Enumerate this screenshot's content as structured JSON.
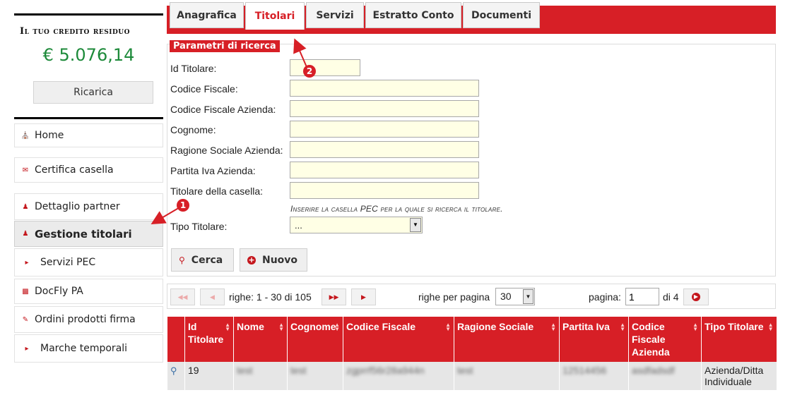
{
  "credit": {
    "title": "Il tuo credito residuo",
    "value": "€ 5.076,14",
    "recharge_label": "Ricarica"
  },
  "nav": {
    "items": [
      {
        "label": "Home",
        "icon": "home-icon"
      },
      {
        "label": "Certifica casella",
        "icon": "envelope-icon"
      },
      {
        "label": "Dettaglio partner",
        "icon": "user-icon"
      },
      {
        "label": "Gestione titolari",
        "icon": "user-icon"
      },
      {
        "label": "Servizi PEC",
        "icon": "caret-right-icon"
      },
      {
        "label": "DocFly PA",
        "icon": "folder-icon"
      },
      {
        "label": "Ordini prodotti firma",
        "icon": "pen-icon"
      },
      {
        "label": "Marche temporali",
        "icon": "caret-right-icon"
      }
    ]
  },
  "tabs": [
    {
      "label": "Anagrafica"
    },
    {
      "label": "Titolari"
    },
    {
      "label": "Servizi"
    },
    {
      "label": "Estratto Conto"
    },
    {
      "label": "Documenti"
    }
  ],
  "search": {
    "heading": "Parametri di ricerca",
    "fields": [
      {
        "label": "Id Titolare:",
        "value": ""
      },
      {
        "label": "Codice Fiscale:",
        "value": ""
      },
      {
        "label": "Codice Fiscale Azienda:",
        "value": ""
      },
      {
        "label": "Cognome:",
        "value": ""
      },
      {
        "label": "Ragione Sociale Azienda:",
        "value": ""
      },
      {
        "label": "Partita Iva Azienda:",
        "value": ""
      },
      {
        "label": "Titolare della casella:",
        "value": ""
      }
    ],
    "pec_hint": "Inserire la casella PEC per la quale si ricerca il titolare.",
    "type_label": "Tipo Titolare:",
    "type_value": "...",
    "search_button": "Cerca",
    "new_button": "Nuovo"
  },
  "pager": {
    "rows_text": "righe: 1 - 30 di 105",
    "per_page_label": "righe per pagina",
    "per_page_value": "30",
    "page_label": "pagina:",
    "page_value": "1",
    "page_total": "di 4"
  },
  "table": {
    "columns": [
      "Id Titolare",
      "Nome",
      "Cognome",
      "Codice Fiscale",
      "Ragione Sociale",
      "Partita Iva",
      "Codice Fiscale Azienda",
      "Tipo Titolare"
    ],
    "rows": [
      {
        "id": "19",
        "nome": "test",
        "cognome": "test",
        "cf": "zgprrf56r28a944n",
        "ragione": "test",
        "piva": "12514456",
        "cf_azienda": "asdfadsdf",
        "tipo": "Azienda/Ditta Individuale"
      }
    ]
  },
  "annotations": {
    "badge_1": "1",
    "badge_2": "2"
  },
  "colors": {
    "accent": "#d71f26",
    "credit": "#1d8a3a",
    "input_bg": "#ffffe5"
  }
}
